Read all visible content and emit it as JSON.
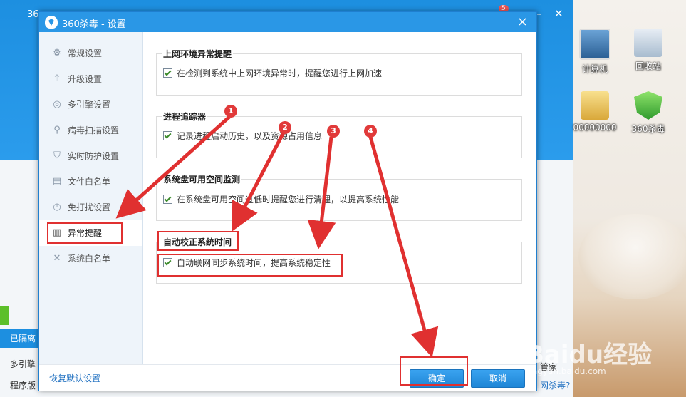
{
  "desktop": {
    "icons": [
      {
        "label": "计算机",
        "icon": "computer-icon"
      },
      {
        "label": "回收站",
        "icon": "recycle-bin-icon"
      },
      {
        "label": "00000000",
        "icon": "folder-icon"
      },
      {
        "label": "360杀毒",
        "icon": "360-shield-icon"
      }
    ],
    "watermark": "Baidu经验",
    "watermark_url": "jingyan.baidu.com"
  },
  "main_window": {
    "title": "36",
    "status_bar": "已隔离",
    "row1": "多引擎",
    "row2": "程序版",
    "right_text1": "管家",
    "right_text2": "网杀毒?",
    "notification_count": "5"
  },
  "dialog": {
    "title": "360杀毒 - 设置",
    "close": "×",
    "sidebar": [
      {
        "label": "常规设置",
        "icon": "gear-icon"
      },
      {
        "label": "升级设置",
        "icon": "upload-icon"
      },
      {
        "label": "多引擎设置",
        "icon": "engine-icon"
      },
      {
        "label": "病毒扫描设置",
        "icon": "search-icon"
      },
      {
        "label": "实时防护设置",
        "icon": "shield-icon"
      },
      {
        "label": "文件白名单",
        "icon": "file-icon"
      },
      {
        "label": "免打扰设置",
        "icon": "clock-icon"
      },
      {
        "label": "异常提醒",
        "icon": "chart-icon"
      },
      {
        "label": "系统白名单",
        "icon": "tools-icon"
      }
    ],
    "groups": [
      {
        "title": "上网环境异常提醒",
        "option": "在检测到系统中上网环境异常时，提醒您进行上网加速"
      },
      {
        "title": "进程追踪器",
        "option": "记录进程启动历史，以及资源占用信息"
      },
      {
        "title": "系统盘可用空间监测",
        "option": "在系统盘可用空间过低时提醒您进行清理，以提高系统性能"
      },
      {
        "title": "自动校正系统时间",
        "option": "自动联网同步系统时间，提高系统稳定性"
      }
    ],
    "footer": {
      "restore": "恢复默认设置",
      "ok": "确定",
      "cancel": "取消"
    }
  },
  "annotations": {
    "badges": [
      "1",
      "2",
      "3",
      "4"
    ],
    "color": "#e03030"
  }
}
